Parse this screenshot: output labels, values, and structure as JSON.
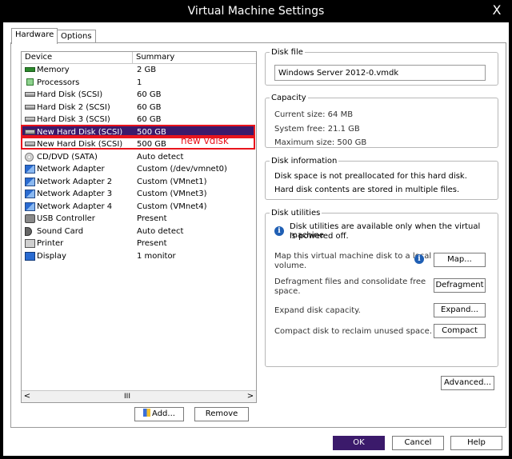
{
  "window": {
    "title": "Virtual Machine Settings",
    "close_glyph": "X"
  },
  "tabs": [
    {
      "label": "Hardware"
    },
    {
      "label": "Options"
    }
  ],
  "device_list": {
    "col_device": "Device",
    "col_summary": "Summary",
    "rows": [
      {
        "device": "Memory",
        "summary": "2 GB",
        "icon": "memory-icon"
      },
      {
        "device": "Processors",
        "summary": "1",
        "icon": "processor-icon"
      },
      {
        "device": "Hard Disk (SCSI)",
        "summary": "60 GB",
        "icon": "hard-disk-icon"
      },
      {
        "device": "Hard Disk 2 (SCSI)",
        "summary": "60 GB",
        "icon": "hard-disk-icon"
      },
      {
        "device": "Hard Disk 3 (SCSI)",
        "summary": "60 GB",
        "icon": "hard-disk-icon"
      },
      {
        "device": "New Hard Disk (SCSI)",
        "summary": "500 GB",
        "icon": "hard-disk-icon"
      },
      {
        "device": "New Hard Disk (SCSI)",
        "summary": "500 GB",
        "icon": "hard-disk-icon"
      },
      {
        "device": "CD/DVD (SATA)",
        "summary": "Auto detect",
        "icon": "cd-dvd-icon"
      },
      {
        "device": "Network Adapter",
        "summary": "Custom (/dev/vmnet0)",
        "icon": "network-adapter-icon"
      },
      {
        "device": "Network Adapter 2",
        "summary": "Custom (VMnet1)",
        "icon": "network-adapter-icon"
      },
      {
        "device": "Network Adapter 3",
        "summary": "Custom (VMnet3)",
        "icon": "network-adapter-icon"
      },
      {
        "device": "Network Adapter 4",
        "summary": "Custom (VMnet4)",
        "icon": "network-adapter-icon"
      },
      {
        "device": "USB Controller",
        "summary": "Present",
        "icon": "usb-icon"
      },
      {
        "device": "Sound Card",
        "summary": "Auto detect",
        "icon": "sound-card-icon"
      },
      {
        "device": "Printer",
        "summary": "Present",
        "icon": "printer-icon"
      },
      {
        "device": "Display",
        "summary": "1 monitor",
        "icon": "display-icon"
      }
    ],
    "selected_index": 5,
    "annotation": "new vdisk",
    "scroll_thumb": "III"
  },
  "list_buttons": {
    "add": "Add...",
    "remove": "Remove"
  },
  "disk_file": {
    "legend": "Disk file",
    "value": "Windows Server 2012-0.vmdk"
  },
  "capacity": {
    "legend": "Capacity",
    "current": "Current size: 64 MB",
    "free": "System free: 21.1 GB",
    "max": "Maximum size: 500 GB"
  },
  "disk_information": {
    "legend": "Disk information",
    "line1": "Disk space is not preallocated for this hard disk.",
    "line2": "Hard disk contents are stored in multiple files."
  },
  "disk_utilities": {
    "legend": "Disk utilities",
    "info_line1": "Disk utilities are available only when the virtual machine",
    "info_line2": "is powered off.",
    "map_text1": "Map this virtual machine disk to a local",
    "map_text2": "volume.",
    "map_button": "Map...",
    "defrag_text1": "Defragment files and consolidate free",
    "defrag_text2": "space.",
    "defrag_button": "Defragment",
    "expand_text": "Expand disk capacity.",
    "expand_button": "Expand...",
    "compact_text": "Compact disk to reclaim unused space.",
    "compact_button": "Compact"
  },
  "advanced_button": "Advanced...",
  "footer": {
    "ok": "OK",
    "cancel": "Cancel",
    "help": "Help"
  },
  "colors": {
    "selection": "#3b1a6b",
    "annotation": "#e8141c",
    "titlebar": "#000000"
  }
}
